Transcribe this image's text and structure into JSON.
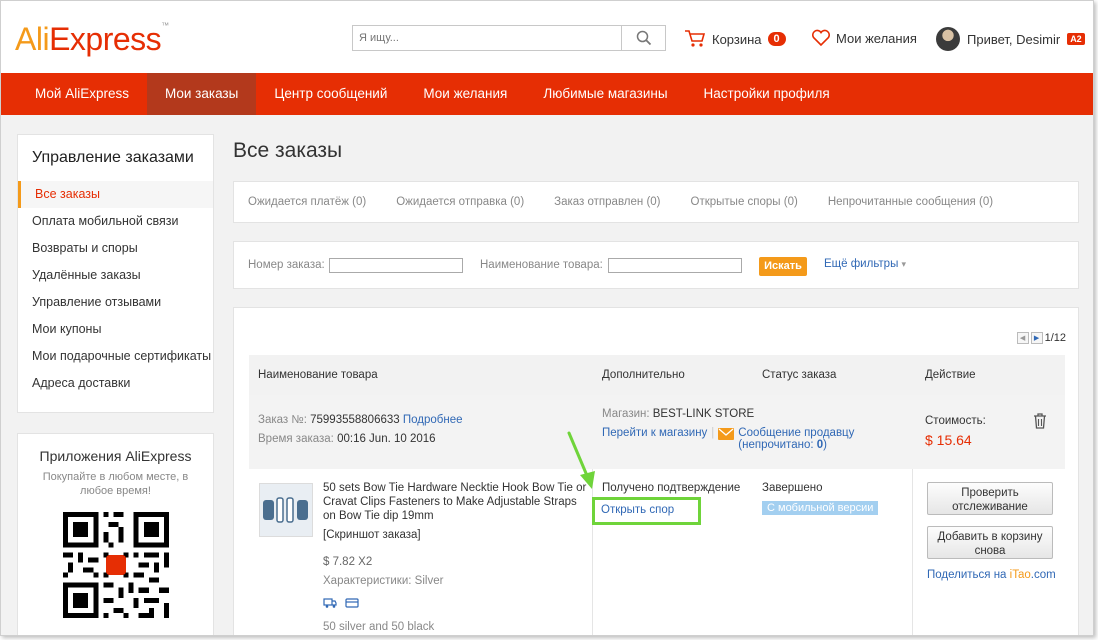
{
  "header": {
    "logo_part1": "Ali",
    "logo_part2": "Express",
    "search_placeholder": "Я ищу...",
    "cart_label": "Корзина",
    "cart_count": "0",
    "wishlist_label": "Мои желания",
    "greeting": "Привет, Desimir",
    "user_level": "A2"
  },
  "nav": {
    "items": [
      "Мой AliExpress",
      "Мои заказы",
      "Центр сообщений",
      "Мои желания",
      "Любимые магазины",
      "Настройки профиля"
    ],
    "active_index": 1
  },
  "sidebar": {
    "title": "Управление заказами",
    "items": [
      "Все заказы",
      "Оплата мобильной связи",
      "Возвраты и споры",
      "Удалённые заказы",
      "Управление отзывами",
      "Мои купоны",
      "Мои подарочные сертификаты",
      "Адреса доставки"
    ],
    "active_index": 0
  },
  "apps": {
    "title": "Приложения AliExpress",
    "subtitle": "Покупайте в любом месте, в любое время!"
  },
  "main": {
    "title": "Все заказы",
    "tabs": [
      "Ожидается платёж (0)",
      "Ожидается отправка (0)",
      "Заказ отправлен (0)",
      "Открытые споры (0)",
      "Непрочитанные сообщения (0)"
    ],
    "filters": {
      "order_number_label": "Номер заказа:",
      "product_name_label": "Наименование товара:",
      "search_button": "Искать",
      "more_filters": "Ещё фильтры"
    },
    "pagination": "1/12",
    "table_headers": [
      "Наименование товара",
      "Дополнительно",
      "Статус заказа",
      "Действие"
    ]
  },
  "order": {
    "number_label": "Заказ №:",
    "number": "75993558806633",
    "details_link": "Подробнее",
    "time_label": "Время заказа:",
    "time": "00:16 Jun. 10 2016",
    "store_label": "Магазин:",
    "store": "BEST-LINK STORE",
    "goto_store": "Перейти к магазину",
    "message_seller": "Сообщение продавцу",
    "unread": "(непрочитано:",
    "unread_count": "0",
    "unread_close": ")",
    "cost_label": "Стоимость:",
    "cost": "$ 15.64",
    "product": {
      "name": "50 sets Bow Tie Hardware Necktie Hook Bow Tie or Cravat Clips Fasteners to Make Adjustable Straps on Bow Tie dip 19mm",
      "snapshot": "[Скриншот заказа]",
      "price": "$ 7.82 X2",
      "attributes": "Характеристики: Silver",
      "note": "50 silver and 50 black"
    },
    "extra_status": "Получено подтверждение",
    "open_dispute": "Открыть спор",
    "status": "Завершено",
    "mobile_badge": "С мобильной версии",
    "track_button": "Проверить отслеживание",
    "add_to_cart_button": "Добавить в корзину снова",
    "share_prefix": "Поделиться на",
    "share_site_1": "iTao",
    "share_site_2": ".com"
  },
  "colors": {
    "brand_red": "#e62e04",
    "brand_orange": "#f49a1a",
    "link_blue": "#3068b5",
    "highlight_green": "#6fd43a"
  }
}
